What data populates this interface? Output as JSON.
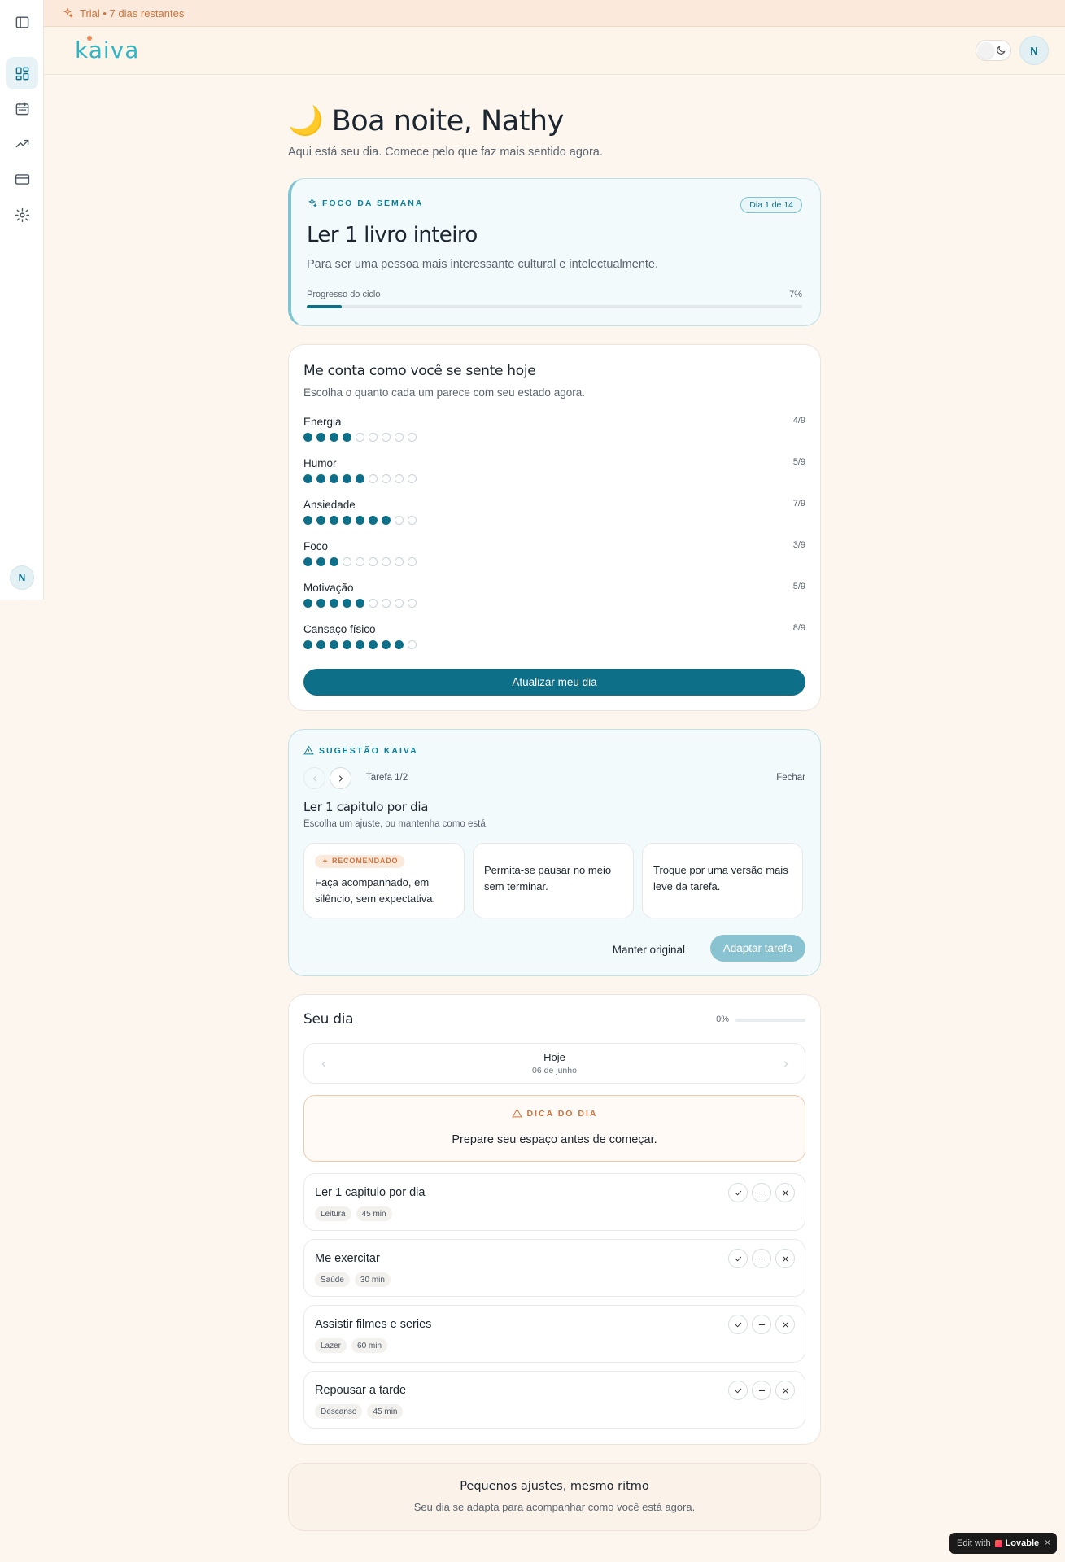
{
  "trial": {
    "text": "Trial • 7 dias restantes"
  },
  "header": {
    "logo": "kaiva",
    "avatar_initial": "N"
  },
  "sidebar": {
    "items": [
      {
        "name": "panel-toggle",
        "icon": "sidebar-toggle-icon"
      },
      {
        "name": "dashboard",
        "icon": "grid-icon",
        "active": true
      },
      {
        "name": "calendar",
        "icon": "calendar-icon"
      },
      {
        "name": "progress",
        "icon": "trending-up-icon"
      },
      {
        "name": "billing",
        "icon": "credit-card-icon"
      },
      {
        "name": "settings",
        "icon": "gear-icon"
      }
    ],
    "avatar_initial": "N"
  },
  "greeting": {
    "emoji": "🌙",
    "text": "Boa noite, Nathy",
    "subtitle": "Aqui está seu dia. Comece pelo que faz mais sentido agora."
  },
  "focus": {
    "eyebrow": "FOCO DA SEMANA",
    "badge": "Dia 1 de 14",
    "title": "Ler 1 livro inteiro",
    "description": "Para ser uma pessoa mais interessante cultural e intelectualmente.",
    "progress_label": "Progresso do ciclo",
    "progress_pct_label": "7%",
    "progress_value": 7
  },
  "feelings": {
    "title": "Me conta como você se sente hoje",
    "subtitle": "Escolha o quanto cada um parece com seu estado agora.",
    "max": 9,
    "metrics": [
      {
        "name": "Energia",
        "value": 4,
        "label": "4/9"
      },
      {
        "name": "Humor",
        "value": 5,
        "label": "5/9"
      },
      {
        "name": "Ansiedade",
        "value": 7,
        "label": "7/9"
      },
      {
        "name": "Foco",
        "value": 3,
        "label": "3/9"
      },
      {
        "name": "Motivação",
        "value": 5,
        "label": "5/9"
      },
      {
        "name": "Cansaço físico",
        "value": 8,
        "label": "8/9"
      }
    ],
    "button": "Atualizar meu dia"
  },
  "suggestion": {
    "eyebrow": "SUGESTÃO KAIVA",
    "counter": "Tarefa 1/2",
    "close": "Fechar",
    "task_title": "Ler 1 capitulo por dia",
    "task_sub": "Escolha um ajuste, ou mantenha como está.",
    "recommended_label": "RECOMENDADO",
    "options": [
      "Faça acompanhado, em silêncio, sem expectativa.",
      "Permita-se pausar no meio sem terminar.",
      "Troque por uma versão mais leve da tarefa."
    ],
    "keep_button": "Manter original",
    "adapt_button": "Adaptar tarefa"
  },
  "day": {
    "title": "Seu dia",
    "progress_label": "0%",
    "date_title": "Hoje",
    "date_sub": "06 de junho",
    "tip_eyebrow": "DICA DO DIA",
    "tip_text": "Prepare seu espaço antes de começar.",
    "tasks": [
      {
        "title": "Ler 1 capitulo por dia",
        "category": "Leitura",
        "duration": "45 min"
      },
      {
        "title": "Me exercitar",
        "category": "Saúde",
        "duration": "30 min"
      },
      {
        "title": "Assistir filmes e series",
        "category": "Lazer",
        "duration": "60 min"
      },
      {
        "title": "Repousar a tarde",
        "category": "Descanso",
        "duration": "45 min"
      }
    ]
  },
  "footer": {
    "title": "Pequenos ajustes, mesmo ritmo",
    "subtitle": "Seu dia se adapta para acompanhar como você está agora."
  },
  "lovable": {
    "prefix": "Edit with",
    "brand": "Lovable",
    "close": "×"
  },
  "colors": {
    "accent": "#0e6f88",
    "trial": "#d0733c",
    "logo": "#2fb5c5"
  }
}
